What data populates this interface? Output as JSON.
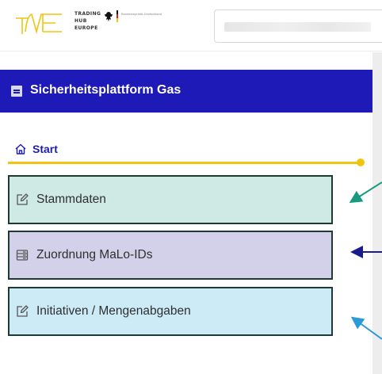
{
  "header": {
    "logo": {
      "mark": "THE",
      "company_lines": [
        "TRADING",
        "HUB",
        "EUROPE"
      ],
      "tagline": "Bundesrepublik Deutschland"
    },
    "search": {
      "value": ""
    }
  },
  "sidebar": {
    "title": "Sicherheitsplattform Gas",
    "start_label": "Start",
    "items": [
      {
        "label": "Stammdaten",
        "icon": "edit-icon",
        "bg": "#cfe9e5"
      },
      {
        "label": "Zuordnung MaLo-IDs",
        "icon": "server-icon",
        "bg": "#d3d1e9"
      },
      {
        "label": "Initiativen / Mengenabgaben",
        "icon": "edit-icon",
        "bg": "#cdeaf7"
      }
    ]
  },
  "colors": {
    "brand_blue": "#1d1ab8",
    "accent_yellow": "#f2c40f",
    "arrow_teal": "#179a80",
    "arrow_navy": "#1a1b8e",
    "arrow_sky": "#2a9bd8"
  }
}
